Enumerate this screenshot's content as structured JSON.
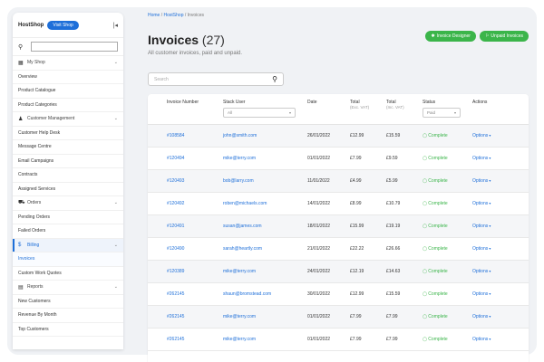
{
  "sidebar": {
    "shop_name": "HostShop",
    "visit_label": "Visit Shop",
    "items": [
      {
        "label": "My Shop",
        "type": "section",
        "icon": "store-icon"
      },
      {
        "label": "Overview",
        "type": "item"
      },
      {
        "label": "Product Catalogue",
        "type": "item"
      },
      {
        "label": "Product Categories",
        "type": "item"
      },
      {
        "label": "Customer Management",
        "type": "section",
        "icon": "user-icon"
      },
      {
        "label": "Customer Help Desk",
        "type": "item"
      },
      {
        "label": "Message Centre",
        "type": "item"
      },
      {
        "label": "Email Campaigns",
        "type": "item"
      },
      {
        "label": "Contracts",
        "type": "item"
      },
      {
        "label": "Assigned Services",
        "type": "item"
      },
      {
        "label": "Orders",
        "type": "section",
        "icon": "cart-icon"
      },
      {
        "label": "Pending Orders",
        "type": "item"
      },
      {
        "label": "Failed Orders",
        "type": "item"
      },
      {
        "label": "Billing",
        "type": "active-section",
        "icon": "dollar-icon"
      },
      {
        "label": "Invoices",
        "type": "active"
      },
      {
        "label": "Custom Work Quotes",
        "type": "item"
      },
      {
        "label": "Reports",
        "type": "section",
        "icon": "report-icon"
      },
      {
        "label": "New Customers",
        "type": "item"
      },
      {
        "label": "Revenue By Month",
        "type": "item"
      },
      {
        "label": "Top Customers",
        "type": "item"
      }
    ]
  },
  "breadcrumb": {
    "home": "Home",
    "sep": "/",
    "shop": "HostShop",
    "current": "Invoices"
  },
  "page": {
    "title": "Invoices",
    "count": "(27)",
    "subtitle": "All customer invoices, paid and unpaid.",
    "designer_label": "Invoice Designer",
    "unpaid_label": "Unpaid Invoices",
    "search_placeholder": "Search"
  },
  "table": {
    "headers": {
      "invoice": "Invoice Number",
      "user": "Stack User",
      "user_filter": "All",
      "date": "Date",
      "total_ex": "Total",
      "total_ex_sub": "(Exc. VAT)",
      "total_inc": "Total",
      "total_inc_sub": "(Inc. VAT)",
      "status": "Status",
      "status_filter": "Paid",
      "actions": "Actions"
    },
    "rows": [
      {
        "invoice": "#108584",
        "user": "john@smith.com",
        "date": "26/01/2022",
        "ex": "£12.99",
        "inc": "£15.59",
        "status": "Complete",
        "actions": "Options"
      },
      {
        "invoice": "#120494",
        "user": "mike@terry.com",
        "date": "01/01/2022",
        "ex": "£7.99",
        "inc": "£9.59",
        "status": "Complete",
        "actions": "Options"
      },
      {
        "invoice": "#120493",
        "user": "bob@larry.com",
        "date": "11/01/2022",
        "ex": "£4.99",
        "inc": "£5.99",
        "status": "Complete",
        "actions": "Options"
      },
      {
        "invoice": "#120492",
        "user": "roben@michaels.com",
        "date": "14/01/2022",
        "ex": "£8.99",
        "inc": "£10.79",
        "status": "Complete",
        "actions": "Options"
      },
      {
        "invoice": "#120491",
        "user": "susan@james.com",
        "date": "18/01/2022",
        "ex": "£15.99",
        "inc": "£19.19",
        "status": "Complete",
        "actions": "Options"
      },
      {
        "invoice": "#120490",
        "user": "sarah@heartly.com",
        "date": "21/01/2022",
        "ex": "£22.22",
        "inc": "£26.66",
        "status": "Complete",
        "actions": "Options"
      },
      {
        "invoice": "#120389",
        "user": "mike@terry.com",
        "date": "24/01/2022",
        "ex": "£12.19",
        "inc": "£14.63",
        "status": "Complete",
        "actions": "Options"
      },
      {
        "invoice": "#262145",
        "user": "shaun@bromstead.com",
        "date": "30/01/2022",
        "ex": "£12.99",
        "inc": "£15.59",
        "status": "Complete",
        "actions": "Options"
      },
      {
        "invoice": "#262145",
        "user": "mike@terry.com",
        "date": "01/01/2022",
        "ex": "£7.99",
        "inc": "£7.99",
        "status": "Complete",
        "actions": "Options"
      },
      {
        "invoice": "#262145",
        "user": "mike@terry.com",
        "date": "01/01/2022",
        "ex": "£7.99",
        "inc": "£7.99",
        "status": "Complete",
        "actions": "Options"
      }
    ]
  },
  "colors": {
    "accent": "#1e6fd9",
    "success": "#3bb54a",
    "background": "#f0f2f5"
  }
}
